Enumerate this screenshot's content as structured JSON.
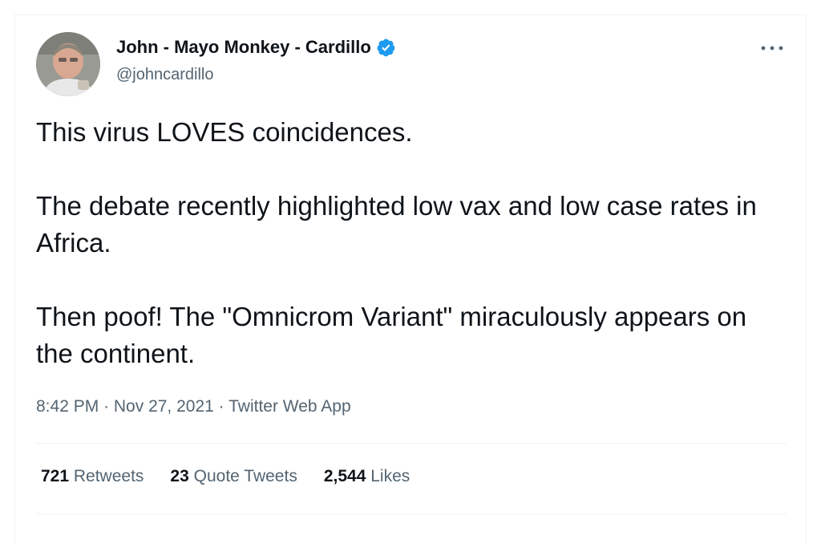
{
  "author": {
    "display_name": "John - Mayo Monkey - Cardillo",
    "handle": "@johncardillo",
    "verified_color": "#1d9bf0"
  },
  "tweet": {
    "paragraphs": [
      "This virus LOVES coincidences.",
      "The debate recently highlighted low vax and low case rates in Africa.",
      "Then poof! The \"Omnicrom Variant\" miraculously appears on the continent."
    ],
    "time": "8:42 PM",
    "separator": "·",
    "date": "Nov 27, 2021",
    "source": "Twitter Web App"
  },
  "stats": {
    "retweets_count": "721",
    "retweets_label": "Retweets",
    "quotes_count": "23",
    "quotes_label": "Quote Tweets",
    "likes_count": "2,544",
    "likes_label": "Likes"
  },
  "icons": {
    "verified": "verified-badge-icon",
    "more": "more-horizontal-icon"
  }
}
